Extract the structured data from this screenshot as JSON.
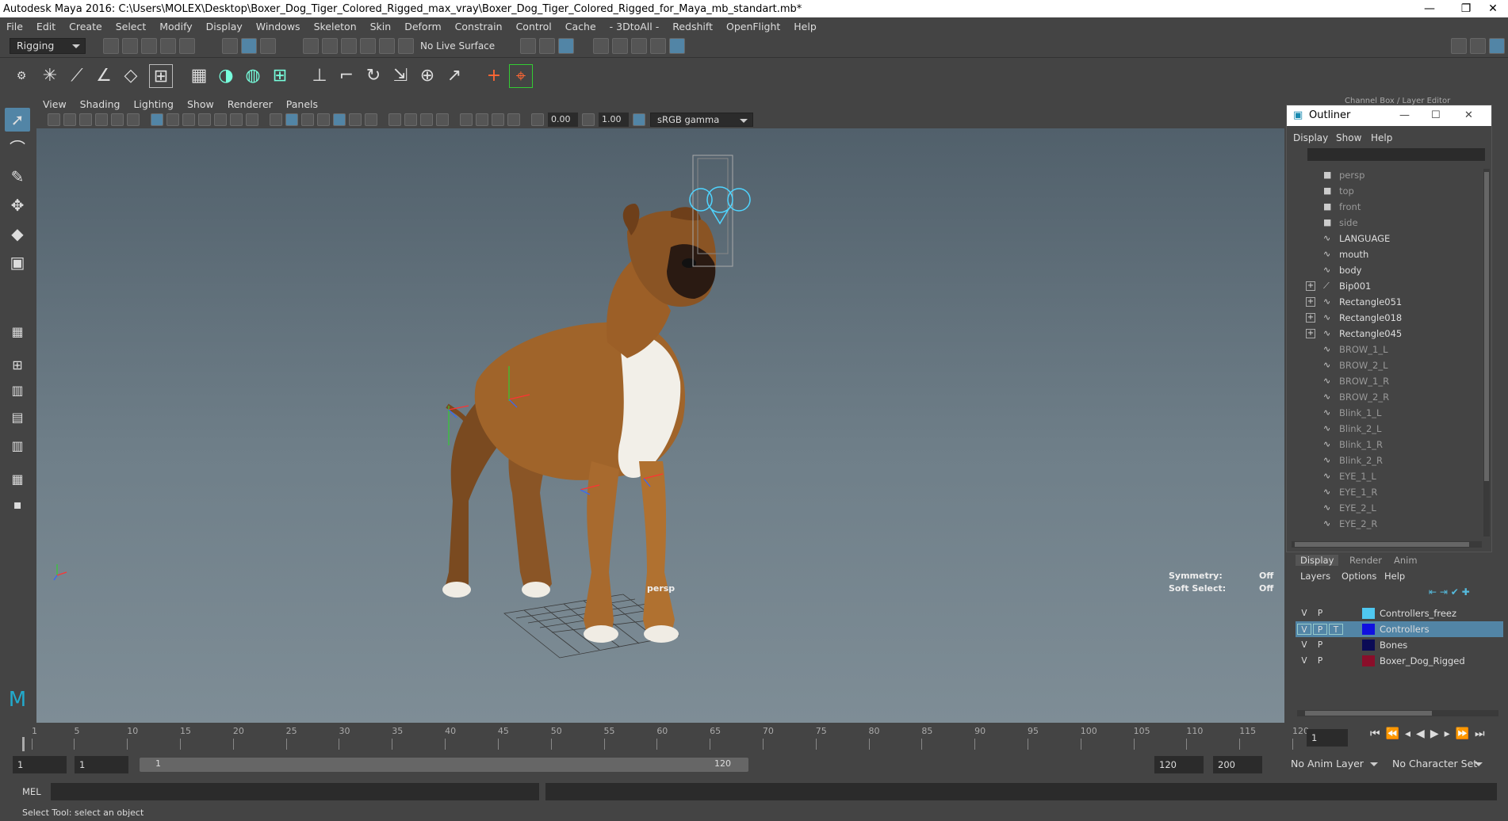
{
  "window": {
    "title": "Autodesk Maya 2016: C:\\Users\\MOLEX\\Desktop\\Boxer_Dog_Tiger_Colored_Rigged_max_vray\\Boxer_Dog_Tiger_Colored_Rigged_for_Maya_mb_standart.mb*",
    "controls": [
      "—",
      "❐",
      "✕"
    ]
  },
  "menu": [
    "File",
    "Edit",
    "Create",
    "Select",
    "Modify",
    "Display",
    "Windows",
    "Skeleton",
    "Skin",
    "Deform",
    "Constrain",
    "Control",
    "Cache",
    "- 3DtoAll -",
    "Redshift",
    "OpenFlight",
    "Help"
  ],
  "statusline": {
    "mode": "Rigging",
    "live_surface": "No Live Surface"
  },
  "viewport": {
    "menu": [
      "View",
      "Shading",
      "Lighting",
      "Show",
      "Renderer",
      "Panels"
    ],
    "exposure": "0.00",
    "gamma": "1.00",
    "color_space": "sRGB gamma",
    "camera_label": "persp",
    "symmetry_label": "Symmetry:",
    "symmetry_value": "Off",
    "soft_select_label": "Soft Select:",
    "soft_select_value": "Off"
  },
  "rightpanel": {
    "header": "Channel Box / Layer Editor"
  },
  "outliner": {
    "title": "Outliner",
    "menu": [
      "Display",
      "Show",
      "Help"
    ],
    "items": [
      {
        "label": "persp",
        "icon": "camera-icon",
        "dim": true,
        "expand": ""
      },
      {
        "label": "top",
        "icon": "camera-icon",
        "dim": true,
        "expand": ""
      },
      {
        "label": "front",
        "icon": "camera-icon",
        "dim": true,
        "expand": ""
      },
      {
        "label": "side",
        "icon": "camera-icon",
        "dim": true,
        "expand": ""
      },
      {
        "label": "LANGUAGE",
        "icon": "curve-icon",
        "dim": false,
        "expand": ""
      },
      {
        "label": "mouth",
        "icon": "curve-icon",
        "dim": false,
        "expand": ""
      },
      {
        "label": "body",
        "icon": "curve-icon",
        "dim": false,
        "expand": ""
      },
      {
        "label": "Bip001",
        "icon": "joint-icon",
        "dim": false,
        "expand": "+"
      },
      {
        "label": "Rectangle051",
        "icon": "curve-icon",
        "dim": false,
        "expand": "+"
      },
      {
        "label": "Rectangle018",
        "icon": "curve-icon",
        "dim": false,
        "expand": "+"
      },
      {
        "label": "Rectangle045",
        "icon": "curve-icon",
        "dim": false,
        "expand": "+"
      },
      {
        "label": "BROW_1_L",
        "icon": "curve-icon",
        "dim": true,
        "expand": ""
      },
      {
        "label": "BROW_2_L",
        "icon": "curve-icon",
        "dim": true,
        "expand": ""
      },
      {
        "label": "BROW_1_R",
        "icon": "curve-icon",
        "dim": true,
        "expand": ""
      },
      {
        "label": "BROW_2_R",
        "icon": "curve-icon",
        "dim": true,
        "expand": ""
      },
      {
        "label": "Blink_1_L",
        "icon": "curve-icon",
        "dim": true,
        "expand": ""
      },
      {
        "label": "Blink_2_L",
        "icon": "curve-icon",
        "dim": true,
        "expand": ""
      },
      {
        "label": "Blink_1_R",
        "icon": "curve-icon",
        "dim": true,
        "expand": ""
      },
      {
        "label": "Blink_2_R",
        "icon": "curve-icon",
        "dim": true,
        "expand": ""
      },
      {
        "label": "EYE_1_L",
        "icon": "curve-icon",
        "dim": true,
        "expand": ""
      },
      {
        "label": "EYE_1_R",
        "icon": "curve-icon",
        "dim": true,
        "expand": ""
      },
      {
        "label": "EYE_2_L",
        "icon": "curve-icon",
        "dim": true,
        "expand": ""
      },
      {
        "label": "EYE_2_R",
        "icon": "curve-icon",
        "dim": true,
        "expand": ""
      }
    ]
  },
  "layer_editor": {
    "tabs": [
      "Display",
      "Render",
      "Anim"
    ],
    "menu": [
      "Layers",
      "Options",
      "Help"
    ],
    "layers": [
      {
        "v": "V",
        "p": "P",
        "t": "",
        "color": "#4fc8f0",
        "name": "Controllers_freez",
        "selected": false
      },
      {
        "v": "V",
        "p": "P",
        "t": "T",
        "color": "#1010e0",
        "name": "Controllers",
        "selected": true
      },
      {
        "v": "V",
        "p": "P",
        "t": "",
        "color": "#0b0b55",
        "name": "Bones",
        "selected": false
      },
      {
        "v": "V",
        "p": "P",
        "t": "",
        "color": "#8a0e2a",
        "name": "Boxer_Dog_Rigged",
        "selected": false
      }
    ]
  },
  "timeline": {
    "ticks": [
      "1",
      "5",
      "10",
      "15",
      "20",
      "25",
      "30",
      "35",
      "40",
      "45",
      "50",
      "55",
      "60",
      "65",
      "70",
      "75",
      "80",
      "85",
      "90",
      "95",
      "100",
      "105",
      "110",
      "115",
      "120"
    ],
    "current_frame": "1"
  },
  "range": {
    "start": "1",
    "playback_start": "1",
    "slider_start": "1",
    "slider_end": "120",
    "playback_end": "120",
    "end": "200",
    "anim_layer": "No Anim Layer",
    "character_set": "No Character Set"
  },
  "cmdline": {
    "label": "MEL"
  },
  "helpline": {
    "text": "Select Tool: select an object"
  }
}
